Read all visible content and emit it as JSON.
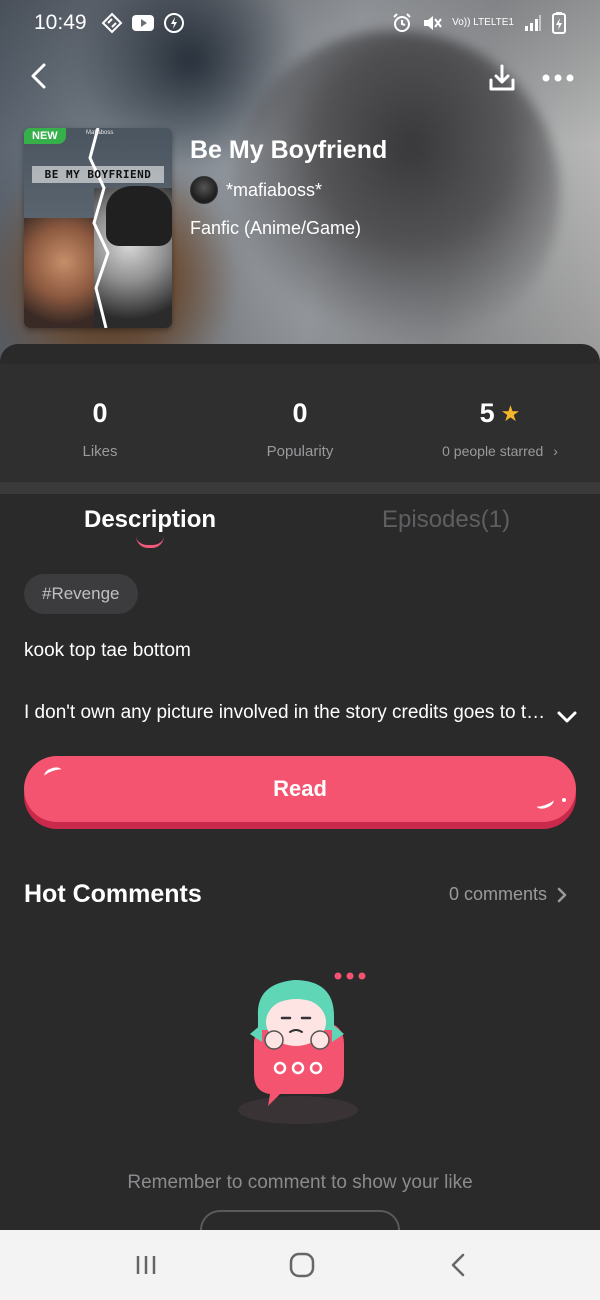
{
  "status_bar": {
    "time": "10:49",
    "network_top": "Vo)) LTE",
    "network_bottom": "LTE1"
  },
  "book": {
    "title": "Be My Boyfriend",
    "author": "*mafiaboss*",
    "genre": "Fanfic (Anime/Game)",
    "cover": {
      "badge": "NEW",
      "author_tag": "Mafiaboss",
      "title": "BE MY BOYFRIEND"
    }
  },
  "stats": {
    "likes_value": "0",
    "likes_label": "Likes",
    "popularity_value": "0",
    "popularity_label": "Popularity",
    "rating_value": "5",
    "starred_label": "0 people starred"
  },
  "tabs": {
    "description": "Description",
    "episodes": "Episodes(1)"
  },
  "tag": "#Revenge",
  "description": {
    "line1": "kook top tae bottom",
    "line2": "I don't own any picture involved in the story credits goes to the rightful owners"
  },
  "read_button": "Read",
  "comments": {
    "title": "Hot Comments",
    "count_label": "0 comments",
    "empty_text": "Remember to comment to show your like"
  },
  "colors": {
    "accent": "#f4546f",
    "accent_shadow": "#c9294a",
    "star": "#f5b72a",
    "panel_bg": "#2a2a2b",
    "badge_green": "#35b04a"
  }
}
